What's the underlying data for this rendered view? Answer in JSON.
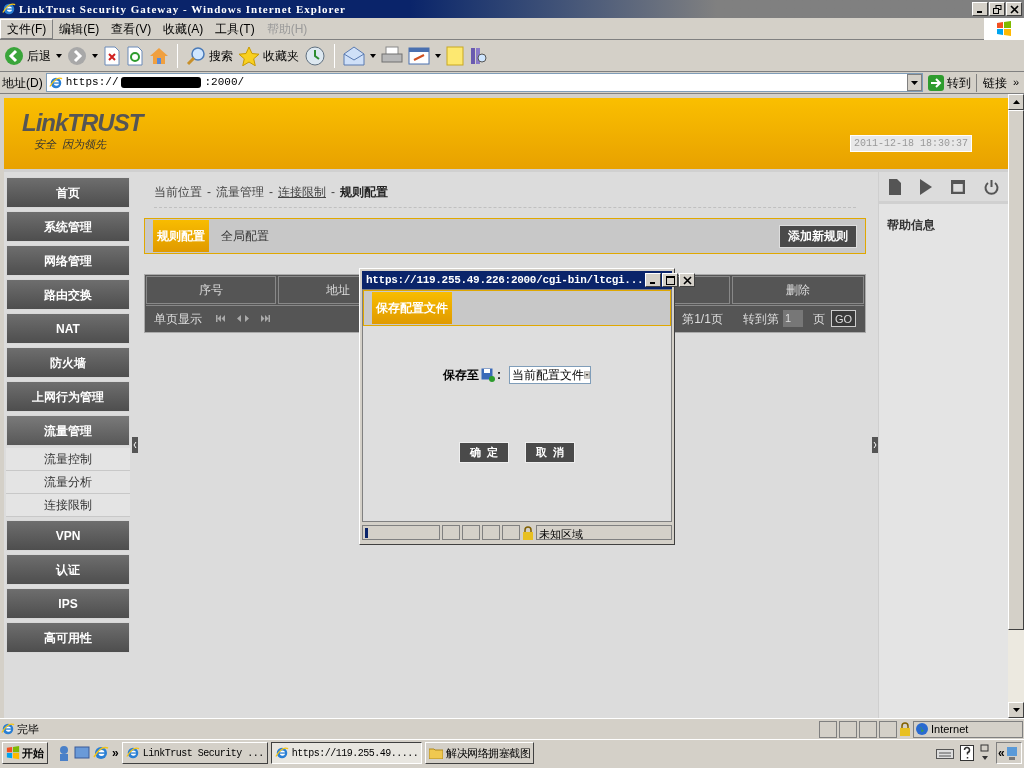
{
  "window": {
    "title": "LinkTrust Security Gateway - Windows Internet Explorer"
  },
  "menu": [
    {
      "label": "文件(F)",
      "disabled": false
    },
    {
      "label": "编辑(E)",
      "disabled": false
    },
    {
      "label": "查看(V)",
      "disabled": false
    },
    {
      "label": "收藏(A)",
      "disabled": false
    },
    {
      "label": "工具(T)",
      "disabled": false
    },
    {
      "label": "帮助(H)",
      "disabled": true
    }
  ],
  "toolbar": {
    "back": "后退",
    "search": "搜索",
    "favorites": "收藏夹"
  },
  "address": {
    "label": "地址(D)",
    "prefix": "https://",
    "suffix": ":2000/",
    "go": "转到",
    "links": "链接",
    "links_more": "»"
  },
  "header": {
    "logo": "LinkTRUST",
    "tagline": "安全  因为领先",
    "datetime": "2011-12-18 18:30:37"
  },
  "sidebar": {
    "items": [
      {
        "label": "首页",
        "expanded": false
      },
      {
        "label": "系统管理",
        "expanded": false
      },
      {
        "label": "网络管理",
        "expanded": false
      },
      {
        "label": "路由交换",
        "expanded": false
      },
      {
        "label": "NAT",
        "expanded": false
      },
      {
        "label": "防火墙",
        "expanded": false
      },
      {
        "label": "上网行为管理",
        "expanded": false
      },
      {
        "label": "流量管理",
        "expanded": true,
        "children": [
          {
            "label": "流量控制"
          },
          {
            "label": "流量分析"
          },
          {
            "label": "连接限制"
          }
        ]
      },
      {
        "label": "VPN",
        "expanded": false
      },
      {
        "label": "认证",
        "expanded": false
      },
      {
        "label": "IPS",
        "expanded": false
      },
      {
        "label": "高可用性",
        "expanded": false
      }
    ]
  },
  "breadcrumb": [
    {
      "kind": "text",
      "text": "当前位置"
    },
    {
      "kind": "sep",
      "text": "-"
    },
    {
      "kind": "text",
      "text": "流量管理"
    },
    {
      "kind": "sep",
      "text": "-"
    },
    {
      "kind": "link",
      "text": "连接限制"
    },
    {
      "kind": "sep",
      "text": "-"
    },
    {
      "kind": "current",
      "text": "规则配置"
    }
  ],
  "tabs": [
    {
      "label": "规则配置",
      "selected": true
    },
    {
      "label": "全局配置",
      "selected": false
    }
  ],
  "add_button": "添加新规则",
  "table": {
    "columns": [
      "序号",
      "地址",
      "删除"
    ],
    "pager": {
      "label": "单页显示",
      "page_info": "第1/1页",
      "goto": "转到第",
      "page_value": "1",
      "page_unit": "页",
      "go": "GO"
    }
  },
  "help": {
    "title": "帮助信息"
  },
  "dialog": {
    "title": "https://119.255.49.226:2000/cgi-bin/ltcgi...",
    "tab": "保存配置文件",
    "field_label": "保存至",
    "colon": ":",
    "select_value": "当前配置文件",
    "ok": "确  定",
    "cancel": "取  消",
    "zone": "未知区域",
    "progress": {
      "level": 0.04
    }
  },
  "status_bar": {
    "text": "完毕",
    "zone": "Internet"
  },
  "taskbar": {
    "start": "开始",
    "more": "»",
    "tasks": [
      {
        "label": "LinkTrust Security ...",
        "selected": false,
        "kind": "ie"
      },
      {
        "label": "https://119.255.49.....",
        "selected": true,
        "kind": "ie"
      },
      {
        "label": "解决网络拥塞截图",
        "selected": false,
        "kind": "folder"
      }
    ],
    "tray_more": "«"
  }
}
